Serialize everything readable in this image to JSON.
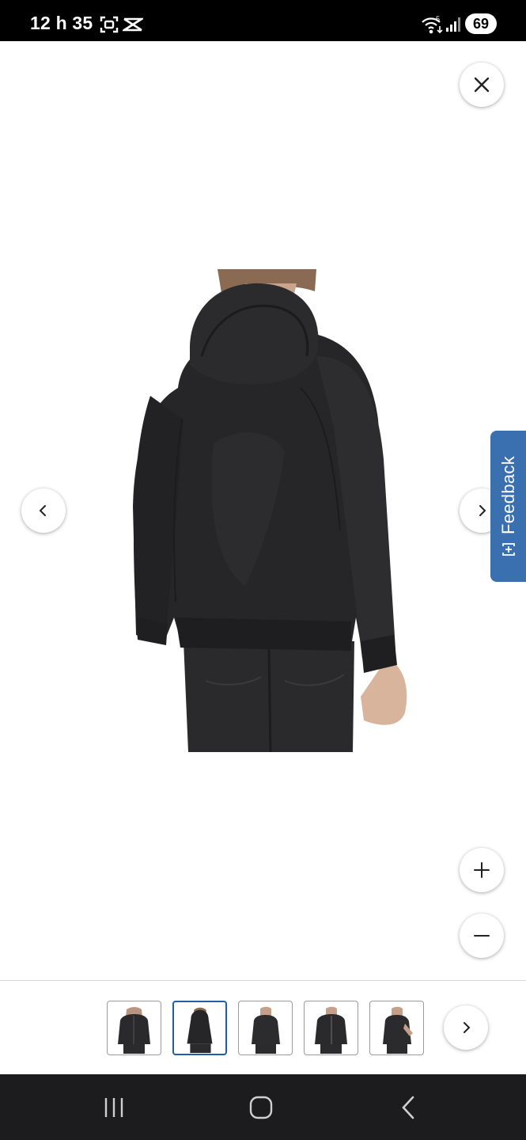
{
  "status_bar": {
    "time": "12 h 35",
    "battery": "69",
    "icons": [
      "screenshot-icon",
      "capcut-icon",
      "wifi-icon",
      "signal-icon",
      "battery-icon"
    ]
  },
  "viewer": {
    "close_icon": "close-icon",
    "prev_icon": "chevron-left-icon",
    "next_icon": "chevron-right-icon",
    "zoom_in_icon": "plus-icon",
    "zoom_out_icon": "minus-icon",
    "image_subject": "black hooded jacket, back view"
  },
  "feedback": {
    "label": "Feedback",
    "icon": "feedback-plus-icon",
    "color": "#3a6fb0"
  },
  "thumbnails": {
    "count": 5,
    "selected_index": 1,
    "selected_color": "#1f5ea8",
    "next_icon": "chevron-right-icon"
  },
  "nav_bar": {
    "icons": [
      "recent-apps-icon",
      "home-icon",
      "back-icon"
    ]
  }
}
